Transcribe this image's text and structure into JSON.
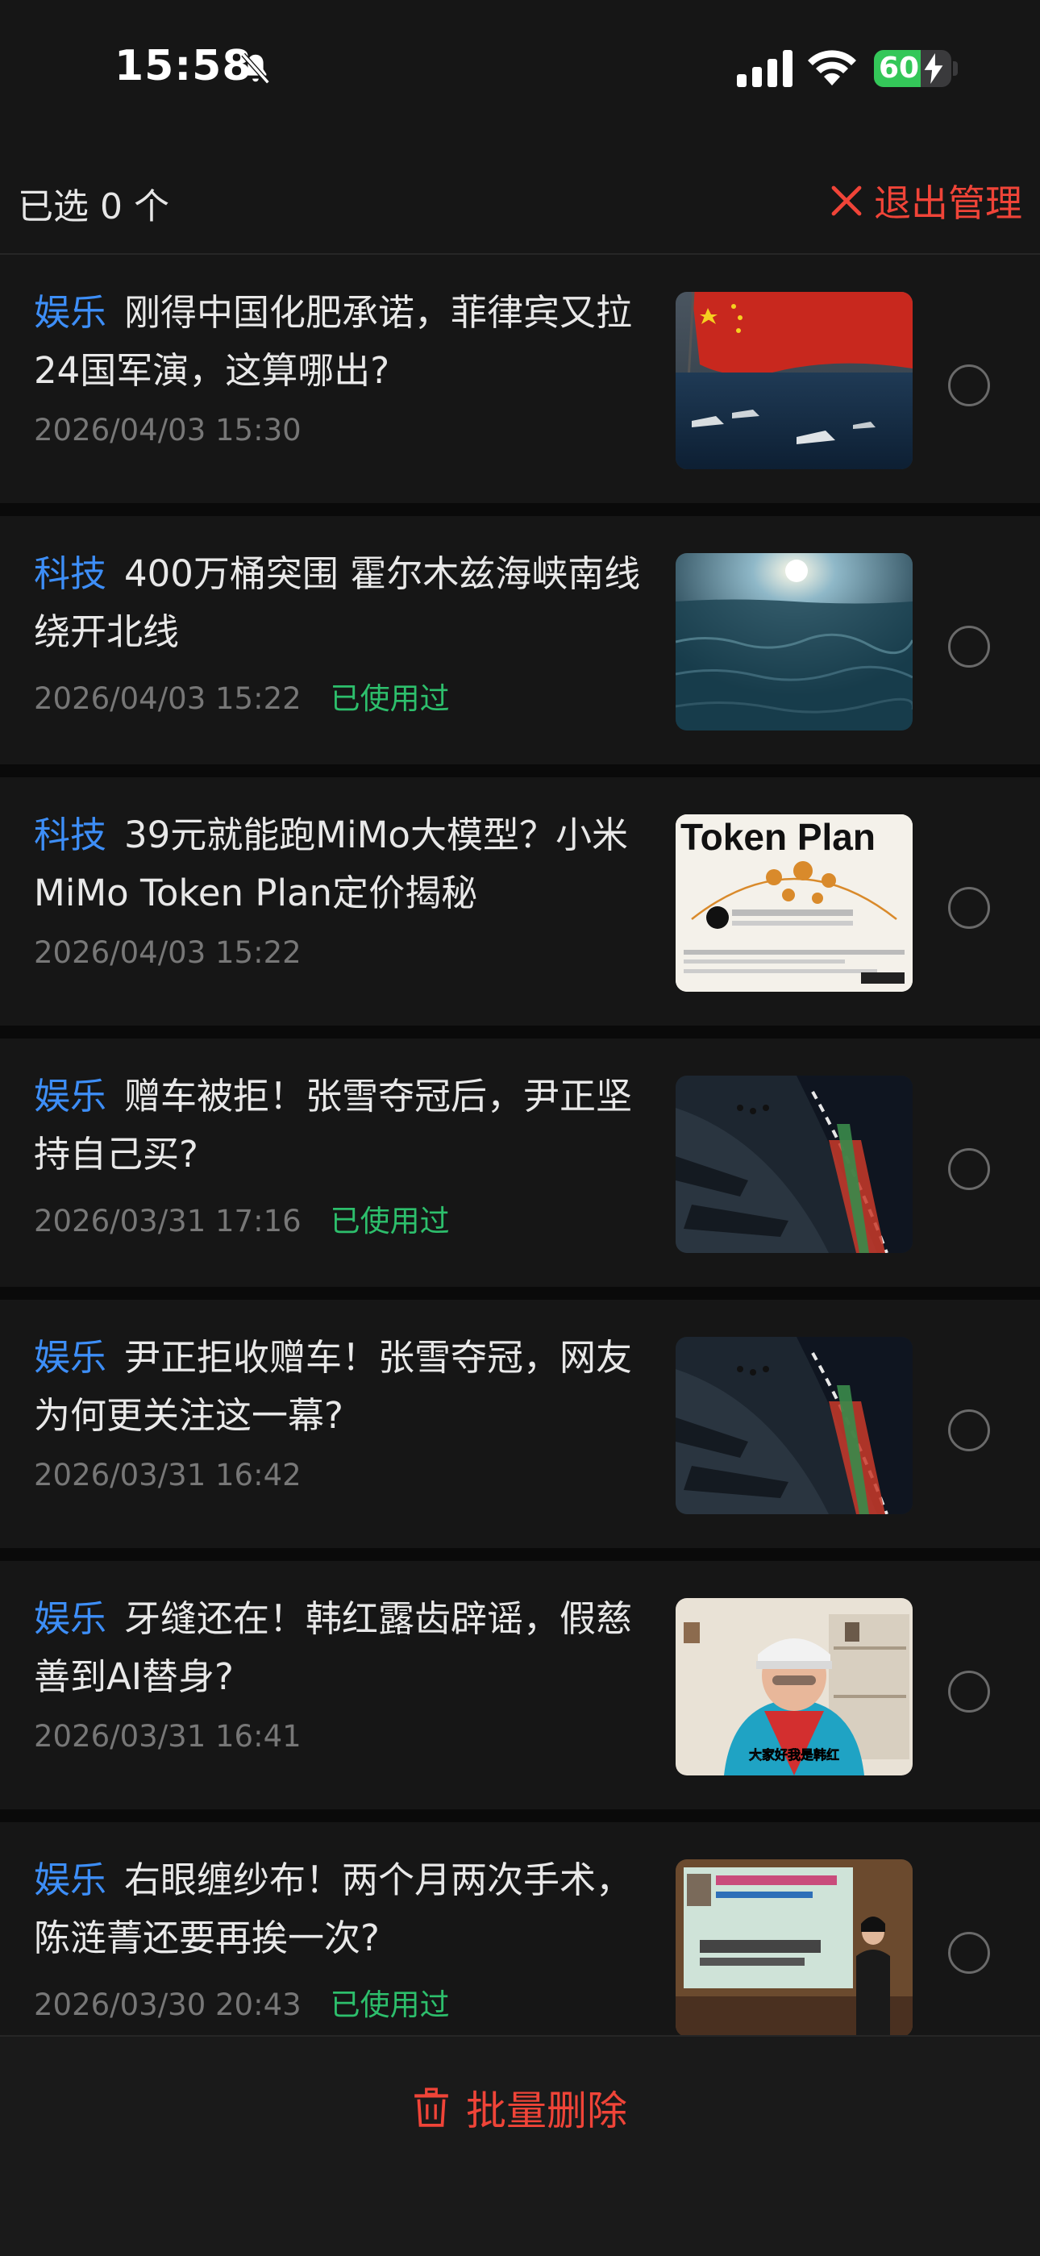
{
  "status_bar": {
    "time": "15:58",
    "battery": "60",
    "battery_percent": 60,
    "icons": [
      "bell-slash-icon",
      "cellular-signal-icon",
      "wifi-icon",
      "battery-charging-icon"
    ]
  },
  "header": {
    "selected_label": "已选 0 个",
    "exit_label": "退出管理"
  },
  "articles": [
    {
      "tag": "娱乐",
      "title": "刚得中国化肥承诺，菲律宾又拉24国军演，这算哪出?",
      "date": "2026/04/03 15:30",
      "used": ""
    },
    {
      "tag": "科技",
      "title": "400万桶突围 霍尔木兹海峡南线绕开北线",
      "date": "2026/04/03 15:22",
      "used": "已使用过"
    },
    {
      "tag": "科技",
      "title": "39元就能跑MiMo大模型？小米MiMo Token Plan定价揭秘",
      "date": "2026/04/03 15:22",
      "used": ""
    },
    {
      "tag": "娱乐",
      "title": "赠车被拒！张雪夺冠后，尹正坚持自己买?",
      "date": "2026/03/31 17:16",
      "used": "已使用过"
    },
    {
      "tag": "娱乐",
      "title": "尹正拒收赠车！张雪夺冠，网友为何更关注这一幕?",
      "date": "2026/03/31 16:42",
      "used": ""
    },
    {
      "tag": "娱乐",
      "title": "牙缝还在！韩红露齿辟谣，假慈善到AI替身?",
      "date": "2026/03/31 16:41",
      "used": ""
    },
    {
      "tag": "娱乐",
      "title": "右眼缠纱布！两个月两次手术，陈涟菁还要再挨一次?",
      "date": "2026/03/30 20:43",
      "used": "已使用过"
    }
  ],
  "thumb_texts": {
    "token_plan": "Token Plan",
    "hanhong_caption": "大家好我是韩红"
  },
  "bottom": {
    "delete_label": "批量删除"
  },
  "colors": {
    "accent_red": "#f04438",
    "tag_blue": "#3d8ef7",
    "used_green": "#2dbf6c",
    "background": "#161616"
  }
}
